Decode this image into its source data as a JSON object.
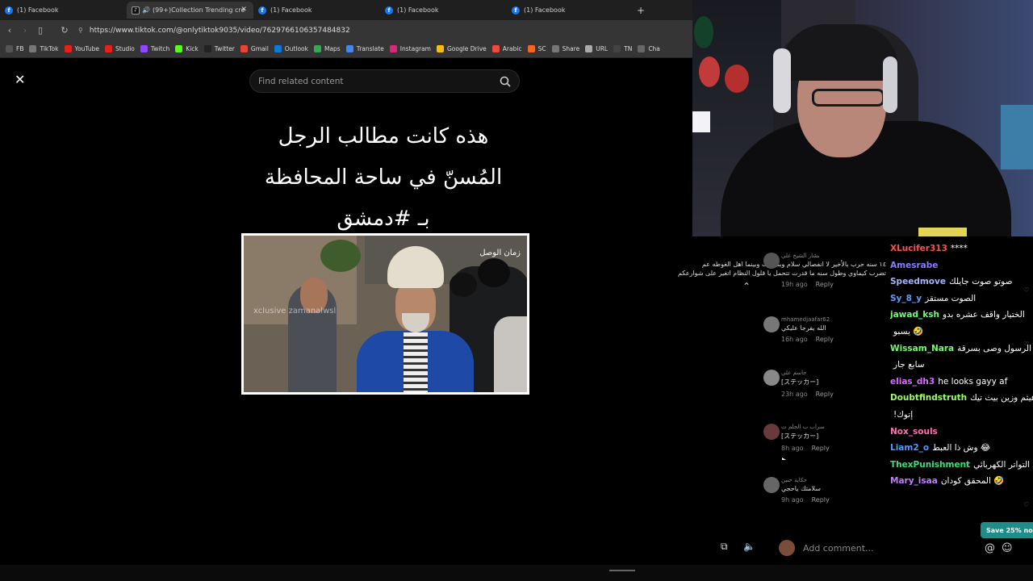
{
  "tabs": [
    {
      "label": "(1) Facebook",
      "icon": "facebook-icon"
    },
    {
      "label": "(99+)Collection Trending cre",
      "icon": "tiktok-icon",
      "active": true
    },
    {
      "label": "(1) Facebook",
      "icon": "facebook-icon"
    },
    {
      "label": "(1) Facebook",
      "icon": "facebook-icon"
    },
    {
      "label": "(1) Facebook",
      "icon": "facebook-icon"
    }
  ],
  "address": {
    "url": "https://www.tiktok.com/@onlytiktok9035/video/7629766106357484832"
  },
  "bookmarks": [
    {
      "label": "FB",
      "color": "#555"
    },
    {
      "label": "TikTok",
      "color": "#777"
    },
    {
      "label": "YouTube",
      "color": "#e62117"
    },
    {
      "label": "Studio",
      "color": "#e62117"
    },
    {
      "label": "Twitch",
      "color": "#9146ff"
    },
    {
      "label": "Kick",
      "color": "#53fc18"
    },
    {
      "label": "Twitter",
      "color": "#222"
    },
    {
      "label": "Gmail",
      "color": "#ea4335"
    },
    {
      "label": "Outlook",
      "color": "#0f78d4"
    },
    {
      "label": "Maps",
      "color": "#34a853"
    },
    {
      "label": "Translate",
      "color": "#4285f4"
    },
    {
      "label": "Instagram",
      "color": "#d62976"
    },
    {
      "label": "Google Drive",
      "color": "#fbbc04"
    },
    {
      "label": "Arabic",
      "color": "#e74c3c"
    },
    {
      "label": "SC",
      "color": "#f26522"
    },
    {
      "label": "Share",
      "color": "#777"
    },
    {
      "label": "URL",
      "color": "#aaa"
    },
    {
      "label": "TN",
      "color": "#444"
    },
    {
      "label": "Cha",
      "color": "#666"
    }
  ],
  "video": {
    "search_placeholder": "Find related content",
    "caption_line1": "هذه كانت مطالب الرجل",
    "caption_line2": "المُسنّ في ساحة المحافظة",
    "caption_line3": "بـ #دمشق",
    "photo_logo": "زمان الوصل",
    "photo_watermark": "xclusive zamanalwsl"
  },
  "comments": [
    {
      "user": "بشار الشيخ علي",
      "text": "١٤ سنه حرب بالأخير لا انفصالي سلام وبنكورت وبينما اهل الغوطه عم",
      "text2": "تضرب كيماوي وطول سنه ما قدرت تتحمل يا قلول النظام اتغير على شوارعكم",
      "time": "19h ago",
      "reply": "Reply"
    },
    {
      "user": "mhamedjaafar62",
      "text": "الله يفرجا عليكي",
      "time": "16h ago",
      "reply": "Reply"
    },
    {
      "user": "جاسم علي",
      "text": "[ステッカー]",
      "time": "23h ago",
      "reply": "Reply"
    },
    {
      "user": "سراب ب الحلم ت",
      "text": "[ステッカー]",
      "time": "8h ago",
      "reply": "Reply"
    },
    {
      "user": "حكاية حنين",
      "text": "سلامتك ياحجي",
      "time": "9h ago",
      "reply": "Reply"
    }
  ],
  "chat": [
    {
      "user": "XLucifer313",
      "msg": "****",
      "color": "#ff4f4f"
    },
    {
      "user": "Amesrabe",
      "msg": "",
      "color": "#8a7bff"
    },
    {
      "user": "Speedmove",
      "msg": "صوتو صوت جايلك",
      "color": "#a6b4ff"
    },
    {
      "user": "Sy_8_y",
      "msg": "الصوت مستقز",
      "color": "#5aa0ff"
    },
    {
      "user": "jawad_ksh",
      "msg": "الختيار واقف عشره بدو",
      "color": "#6cff6c"
    },
    {
      "user": "",
      "msg": "يسبو 🤣",
      "color": "#6cff6c"
    },
    {
      "user": "Wissam_Nara",
      "msg": "الرسول وصى بسرقة",
      "color": "#6cff6c"
    },
    {
      "user": "",
      "msg": "سابع جار",
      "color": "#6cff6c"
    },
    {
      "user": "elias_dh3",
      "msg": "he looks gayy af",
      "color": "#d46cff"
    },
    {
      "user": "Doubtfindstruth",
      "msg": "هيثم وزين بيث تيك",
      "color": "#9bff6c"
    },
    {
      "user": "",
      "msg": "!إتوك",
      "color": "#9bff6c"
    },
    {
      "user": "Nox_souls",
      "msg": "",
      "color": "#ff6fb2"
    },
    {
      "user": "Liam2_o",
      "msg": "وش ذا العبط 😂",
      "color": "#4f9bff"
    },
    {
      "user": "ThexPunishment",
      "msg": "التواتر الكهربائي",
      "color": "#38e07b"
    },
    {
      "user": "Mary_isaa",
      "msg": "المحقق كودان 🤣",
      "color": "#c47cff"
    }
  ],
  "add_comment": {
    "placeholder": "Add comment..."
  },
  "promo": {
    "label": "Save 25% no"
  }
}
